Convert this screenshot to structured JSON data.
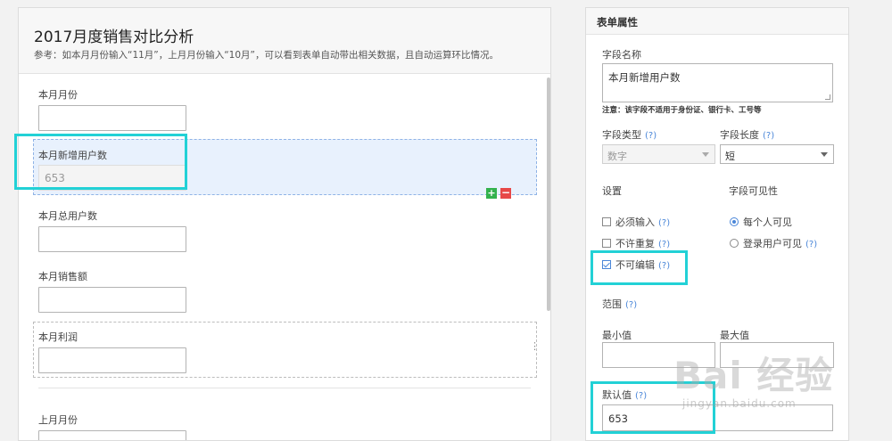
{
  "form": {
    "title": "2017月度销售对比分析",
    "description": "参考：如本月月份输入“11月”，上月月份输入“10月”，可以看到表单自动带出相关数据，且自动运算环比情况。",
    "fields": [
      {
        "label": "本月月份",
        "value": ""
      },
      {
        "label": "本月新增用户数",
        "value": "653"
      },
      {
        "label": "本月总用户数",
        "value": ""
      },
      {
        "label": "本月销售额",
        "value": ""
      },
      {
        "label": "本月利润",
        "value": ""
      },
      {
        "label": "上月月份",
        "value": ""
      }
    ],
    "add_symbol": "+",
    "remove_symbol": "−",
    "drag_symbol": "⋮"
  },
  "props": {
    "title": "表单属性",
    "field_name_label": "字段名称",
    "field_name_value": "本月新增用户数",
    "field_name_note": "注意：该字段不适用于身份证、银行卡、工号等",
    "field_type_label": "字段类型",
    "field_type_value": "数字",
    "field_length_label": "字段长度",
    "field_length_value": "短",
    "help": "(?)",
    "settings_label": "设置",
    "visibility_label": "字段可见性",
    "required_label": "必须输入",
    "no_duplicate_label": "不许重复",
    "readonly_label": "不可编辑",
    "everyone_label": "每个人可见",
    "logged_in_label": "登录用户可见",
    "range_label": "范围",
    "min_label": "最小值",
    "max_label": "最大值",
    "default_label": "默认值",
    "default_value": "653"
  },
  "watermark": {
    "logo": "Bai 经验",
    "url": "jingyan.baidu.com"
  },
  "colors": {
    "highlight": "#22d1d6",
    "link": "#4a86d8",
    "selected_bg": "#e8f1fd"
  }
}
